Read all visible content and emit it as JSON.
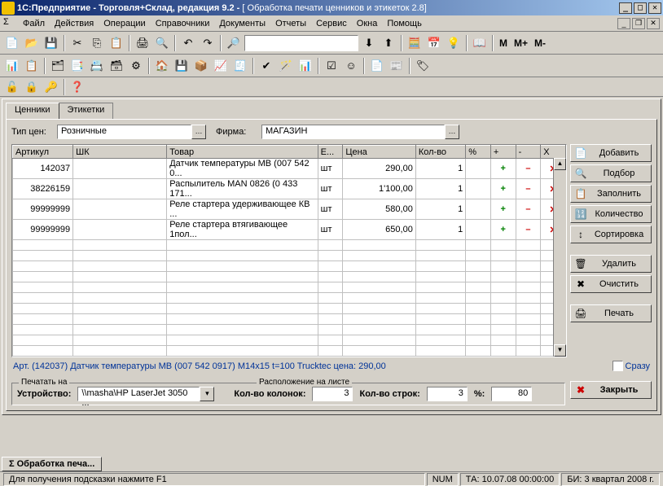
{
  "title": {
    "app": "1С:Предприятие - Торговля+Склад, редакция 9.2 - ",
    "doc": "[ Обработка печати ценников и этикеток 2.8]"
  },
  "menu": [
    "Файл",
    "Действия",
    "Операции",
    "Справочники",
    "Документы",
    "Отчеты",
    "Сервис",
    "Окна",
    "Помощь"
  ],
  "tabs": {
    "price": "Ценники",
    "label": "Этикетки"
  },
  "filters": {
    "price_type_label": "Тип цен:",
    "price_type_value": "Розничные",
    "firm_label": "Фирма:",
    "firm_value": "МАГАЗИН"
  },
  "grid": {
    "cols": [
      "Артикул",
      "ШК",
      "Товар",
      "Е...",
      "Цена",
      "Кол-во",
      "%",
      "+",
      "-",
      "X"
    ],
    "rows": [
      {
        "art": "142037",
        "bc": "",
        "name": "Датчик температуры MB (007 542 0...",
        "unit": "шт",
        "price": "290,00",
        "qty": "1",
        "pct": "",
        "p": "+",
        "m": "–",
        "x": "✕"
      },
      {
        "art": "38226159",
        "bc": "",
        "name": "Распылитель MAN 0826 (0 433 171...",
        "unit": "шт",
        "price": "1'100,00",
        "qty": "1",
        "pct": "",
        "p": "+",
        "m": "–",
        "x": "✕"
      },
      {
        "art": "99999999",
        "bc": "",
        "name": "Реле стартера удерживающее КВ ...",
        "unit": "шт",
        "price": "580,00",
        "qty": "1",
        "pct": "",
        "p": "+",
        "m": "–",
        "x": "✕"
      },
      {
        "art": "99999999",
        "bc": "",
        "name": "Реле стартера втягивающее 1пол...",
        "unit": "шт",
        "price": "650,00",
        "qty": "1",
        "pct": "",
        "p": "+",
        "m": "–",
        "x": "✕"
      }
    ]
  },
  "side": {
    "add": "Добавить",
    "pick": "Подбор",
    "fill": "Заполнить",
    "qty": "Количество",
    "sort": "Сортировка",
    "del": "Удалить",
    "clear": "Очистить",
    "print": "Печать",
    "now": "Сразу",
    "close": "Закрыть"
  },
  "info": "Арт. (142037) Датчик температуры MB (007 542 0917) M14x15 t=100 Trucktec цена: 290,00",
  "print": {
    "panel1": "Печатать на",
    "device_label": "Устройство:",
    "device_value": "\\\\masha\\HP LaserJet 3050 ...",
    "panel2": "Расположение на листе",
    "cols_label": "Кол-во колонок:",
    "cols_value": "3",
    "rows_label": "Кол-во строк:",
    "rows_value": "3",
    "pct_label": "%:",
    "pct_value": "80"
  },
  "task": "Обработка печа...",
  "status": {
    "hint": "Для получения подсказки нажмите F1",
    "num": "NUM",
    "ta": "ТА: 10.07.08  00:00:00",
    "bi": "БИ: 3 квартал 2008 г."
  }
}
